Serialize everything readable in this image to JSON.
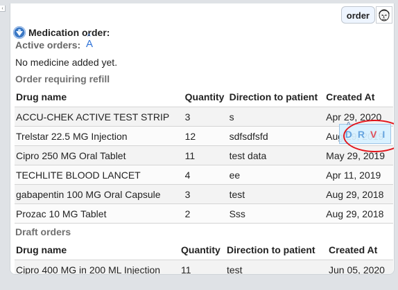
{
  "header": {
    "order_label": "order",
    "avatar": "user-avatar"
  },
  "medication": {
    "title": "Medication order:",
    "active_orders_label": "Active orders:",
    "font_size_icon": "A",
    "empty_message": "No medicine added yet."
  },
  "refill": {
    "section_title": "Order requiring refill",
    "columns": [
      "Drug name",
      "Quantity",
      "Direction to patient",
      "Created At"
    ],
    "rows": [
      [
        "ACCU-CHEK ACTIVE TEST STRIP",
        "3",
        "s",
        "Apr 29, 2020"
      ],
      [
        "Trelstar 22.5 MG Injection",
        "12",
        "sdfsdfsfd",
        "Aug 29, 2019"
      ],
      [
        "Cipro 250 MG Oral Tablet",
        "11",
        "test data",
        "May 29, 2019"
      ],
      [
        "TECHLITE BLOOD LANCET",
        "4",
        "ee",
        "Apr 11, 2019"
      ],
      [
        "gabapentin 100 MG Oral Capsule",
        "3",
        "test",
        "Aug 29, 2018"
      ],
      [
        "Prozac 10 MG Tablet",
        "2",
        "Sss",
        "Aug 29, 2018"
      ]
    ]
  },
  "drafts": {
    "section_title": "Draft orders",
    "columns": [
      "Drug name",
      "Quantity",
      "Direction to patient",
      "Created At"
    ],
    "rows": [
      [
        "Cipro 400 MG in 200 ML Injection",
        "11",
        "test",
        "Jun 05, 2020"
      ]
    ]
  },
  "row_actions": {
    "d": "D",
    "r": "R",
    "v": "V",
    "i": "I"
  },
  "colors": {
    "accent_blue": "#2f73d8",
    "annotation_red": "#e2151b",
    "action_v_red": "#e0505a",
    "action_blue": "#66a4df"
  },
  "icons": {
    "handle": "collapse-arrow-icon",
    "medication": "medication-icon",
    "font_size": "font-size-icon",
    "avatar": "user-avatar-icon"
  }
}
